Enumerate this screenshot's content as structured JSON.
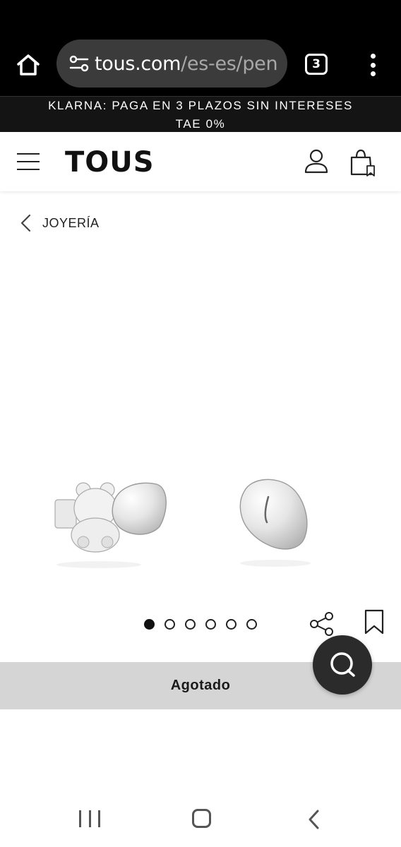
{
  "browser": {
    "url_host": "tous.com",
    "url_path": "/es-es/pen",
    "tab_count": "3",
    "icons": [
      "home-icon",
      "site-settings-icon",
      "tab-switcher-icon",
      "more-vert-icon"
    ]
  },
  "promo": {
    "line1": "KLARNA: PAGA EN 3 PLAZOS SIN INTERESES",
    "line2": "TAE 0%"
  },
  "header": {
    "logo": "TOUS",
    "icons": [
      "hamburger-menu-icon",
      "user-icon",
      "shopping-bag-icon"
    ]
  },
  "breadcrumb": {
    "label": "JOYERÍA"
  },
  "carousel": {
    "total_slides": 6,
    "active_index": 0
  },
  "product": {
    "status_label": "Agotado"
  },
  "colors": {
    "browser_bg": "#000000",
    "url_pill": "#3b3b3b",
    "promo_bg": "#141414",
    "soldout_bg": "#d5d5d5",
    "chat_fab": "#2b2b2b"
  }
}
